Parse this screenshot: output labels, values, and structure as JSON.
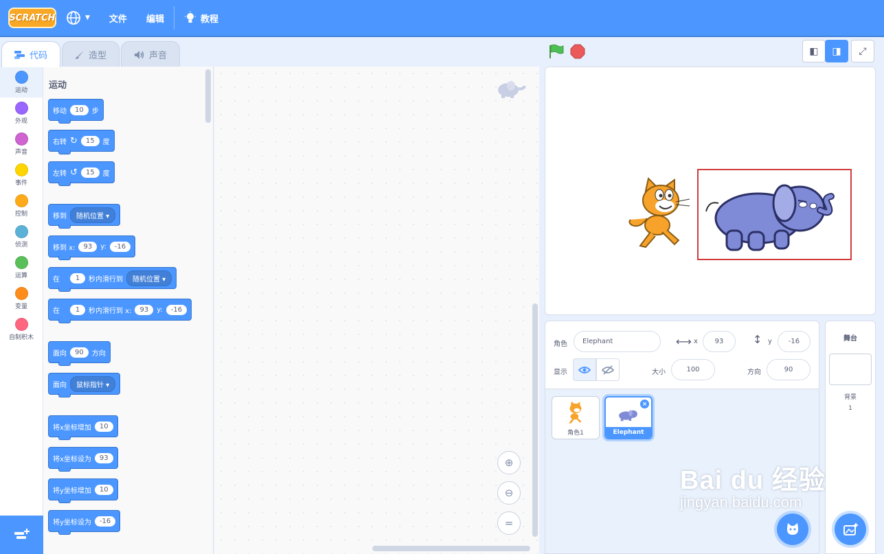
{
  "menubar": {
    "logo_text": "SCRATCH",
    "file": "文件",
    "edit": "编辑",
    "tutorials": "教程"
  },
  "tabs": {
    "code": "代码",
    "costumes": "造型",
    "sounds": "声音"
  },
  "categories": [
    {
      "label": "运动",
      "color": "#4c97ff"
    },
    {
      "label": "外观",
      "color": "#9966ff"
    },
    {
      "label": "声音",
      "color": "#cf63cf"
    },
    {
      "label": "事件",
      "color": "#ffd500"
    },
    {
      "label": "控制",
      "color": "#ffab19"
    },
    {
      "label": "侦测",
      "color": "#5cb1d6"
    },
    {
      "label": "运算",
      "color": "#59c059"
    },
    {
      "label": "变量",
      "color": "#ff8c1a"
    },
    {
      "label": "自制积木",
      "color": "#ff6680"
    }
  ],
  "palette": {
    "title": "运动",
    "move": {
      "label": "移动",
      "steps": "10",
      "unit": "步"
    },
    "turn_right": {
      "label": "右转",
      "degrees": "15",
      "unit": "度"
    },
    "turn_left": {
      "label": "左转",
      "degrees": "15",
      "unit": "度"
    },
    "goto": {
      "label": "移到",
      "target": "随机位置"
    },
    "goto_xy": {
      "label": "移到 x:",
      "x": "93",
      "y_label": "y:",
      "y": "-16"
    },
    "glide": {
      "prefix": "在",
      "secs": "1",
      "mid": "秒内滑行到",
      "target": "随机位置"
    },
    "glide_xy": {
      "prefix": "在",
      "secs": "1",
      "mid": "秒内滑行到 x:",
      "x": "93",
      "y_label": "y:",
      "y": "-16"
    },
    "point_dir": {
      "label": "面向",
      "value": "90",
      "unit": "方向"
    },
    "point_towards": {
      "label": "面向",
      "target": "鼠标指针"
    },
    "change_x": {
      "label": "将x坐标增加",
      "value": "10"
    },
    "set_x": {
      "label": "将x坐标设为",
      "value": "93"
    },
    "change_y": {
      "label": "将y坐标增加",
      "value": "10"
    },
    "set_y": {
      "label": "将y坐标设为",
      "value": "-16"
    }
  },
  "sprite_info": {
    "sprite_label": "角色",
    "sprite_name": "Elephant",
    "x_label": "x",
    "x": "93",
    "y_label": "y",
    "y": "-16",
    "show_label": "显示",
    "size_label": "大小",
    "size": "100",
    "direction_label": "方向",
    "direction": "90"
  },
  "sprites": [
    {
      "name": "角色1",
      "selected": false
    },
    {
      "name": "Elephant",
      "selected": true
    }
  ],
  "stage_pane": {
    "title": "舞台",
    "backdrops_label": "背景",
    "backdrops_count": "1"
  },
  "watermark": {
    "main": "Bai du 经验",
    "sub": "jingyan.baidu.com"
  },
  "colors": {
    "accent": "#4c97ff",
    "highlight": "#d23a3a"
  }
}
